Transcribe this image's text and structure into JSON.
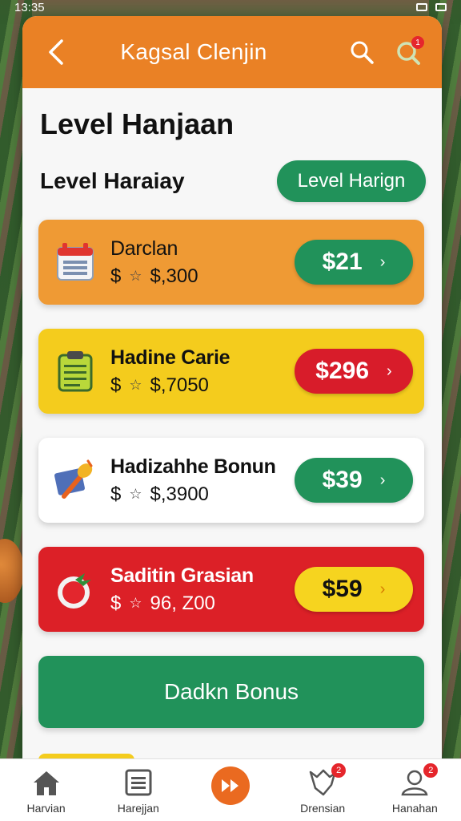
{
  "status_bar": {
    "time": "13:35"
  },
  "header": {
    "title": "Kagsal Clenjin",
    "notification_count": "1"
  },
  "page": {
    "title": "Level Hanjaan",
    "subtitle": "Level Haraiay",
    "pill_button": "Level Harign"
  },
  "cards": [
    {
      "name": "Darclan",
      "meta_prefix": "$",
      "meta_value": "$,300",
      "price": "$21",
      "theme": "orange",
      "price_color": "green",
      "icon": "calendar-icon"
    },
    {
      "name": "Hadine Carie",
      "meta_prefix": "$",
      "meta_value": "$,7050",
      "price": "$296",
      "theme": "yellow",
      "price_color": "red",
      "icon": "clipboard-icon"
    },
    {
      "name": "Hadizahhe Bonun",
      "meta_prefix": "$",
      "meta_value": "$,3900",
      "price": "$39",
      "theme": "white",
      "price_color": "green",
      "icon": "brush-icon"
    },
    {
      "name": "Saditin Grasian",
      "meta_prefix": "$",
      "meta_value": "96, Z00",
      "price": "$59",
      "theme": "red",
      "price_color": "yellow",
      "icon": "tomato-icon"
    }
  ],
  "cta": {
    "label": "Dadkn Bonus"
  },
  "bottom_nav": [
    {
      "label": "Harvian",
      "icon": "home-icon"
    },
    {
      "label": "Harejjan",
      "icon": "list-icon"
    },
    {
      "label": "",
      "icon": "fast-forward-icon"
    },
    {
      "label": "Drensian",
      "icon": "chat-icon",
      "badge": "2"
    },
    {
      "label": "Hanahan",
      "icon": "user-icon",
      "badge": "2"
    }
  ],
  "colors": {
    "header": "#ea8125",
    "green": "#21925a",
    "red": "#dc2027",
    "yellow": "#f4cc1d",
    "orange": "#ef9a34"
  }
}
